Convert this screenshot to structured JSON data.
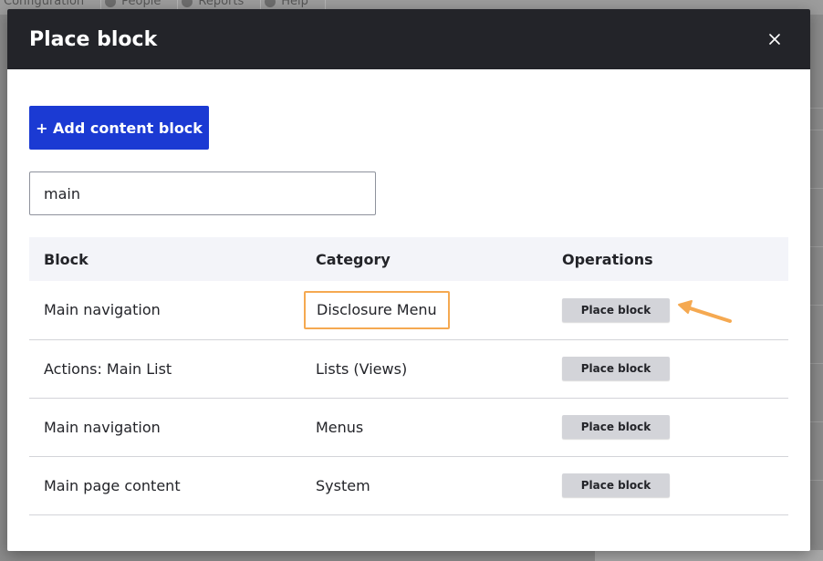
{
  "background": {
    "toolbar_items": [
      "Configuration",
      "People",
      "Reports",
      "Help"
    ]
  },
  "dialog": {
    "title": "Place block",
    "close_icon": "close-icon",
    "add_button_label": "+ Add content block",
    "filter_value": "main"
  },
  "table": {
    "headers": [
      "Block",
      "Category",
      "Operations"
    ],
    "rows": [
      {
        "block": "Main navigation",
        "category": "Disclosure Menu",
        "operation": "Place block"
      },
      {
        "block": "Actions: Main List",
        "category": "Lists (Views)",
        "operation": "Place block"
      },
      {
        "block": "Main navigation",
        "category": "Menus",
        "operation": "Place block"
      },
      {
        "block": "Main page content",
        "category": "System",
        "operation": "Place block"
      }
    ]
  },
  "colors": {
    "header_bg": "#232429",
    "primary_button": "#1b3ad3",
    "highlight": "#f5a951"
  }
}
